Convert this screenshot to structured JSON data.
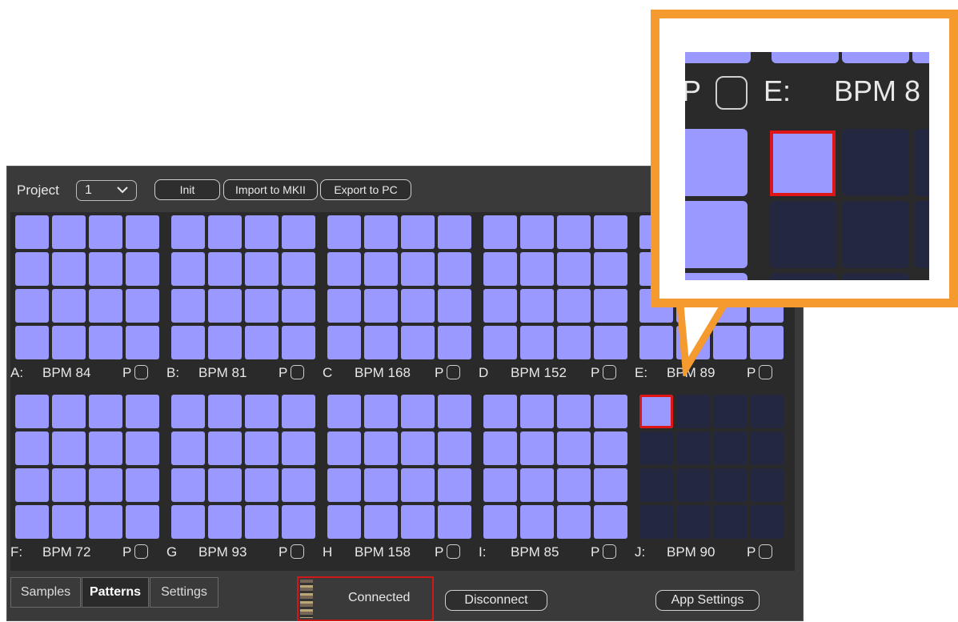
{
  "toolbar": {
    "project_label": "Project",
    "project_value": "1",
    "buttons": [
      "Init",
      "Import to MKII",
      "Export to PC"
    ]
  },
  "patterns": [
    {
      "letter": "A:",
      "bpm": "BPM 84",
      "p": "P"
    },
    {
      "letter": "B:",
      "bpm": "BPM 81",
      "p": "P"
    },
    {
      "letter": "C",
      "bpm": "BPM 168",
      "p": "P"
    },
    {
      "letter": "D",
      "bpm": "BPM 152",
      "p": "P"
    },
    {
      "letter": "E:",
      "bpm": "BPM 89",
      "p": "P"
    },
    {
      "letter": "F:",
      "bpm": "BPM 72",
      "p": "P"
    },
    {
      "letter": "G",
      "bpm": "BPM 93",
      "p": "P"
    },
    {
      "letter": "H",
      "bpm": "BPM 158",
      "p": "P"
    },
    {
      "letter": "I:",
      "bpm": "BPM 85",
      "p": "P"
    },
    {
      "letter": "J:",
      "bpm": "BPM 90",
      "p": "P"
    }
  ],
  "tabs": [
    {
      "label": "Samples",
      "active": false
    },
    {
      "label": "Patterns",
      "active": true
    },
    {
      "label": "Settings",
      "active": false
    }
  ],
  "status": {
    "connection_text": "Connected",
    "disconnect_label": "Disconnect",
    "app_settings_label": "App Settings"
  },
  "zoom": {
    "p_label": "P",
    "letter": "E:",
    "bpm_partial": "BPM 8"
  },
  "colors": {
    "pad_on": "#9999ff",
    "pad_off": "#232840",
    "selected_outline": "#e01616",
    "callout_border": "#f49a2e"
  }
}
